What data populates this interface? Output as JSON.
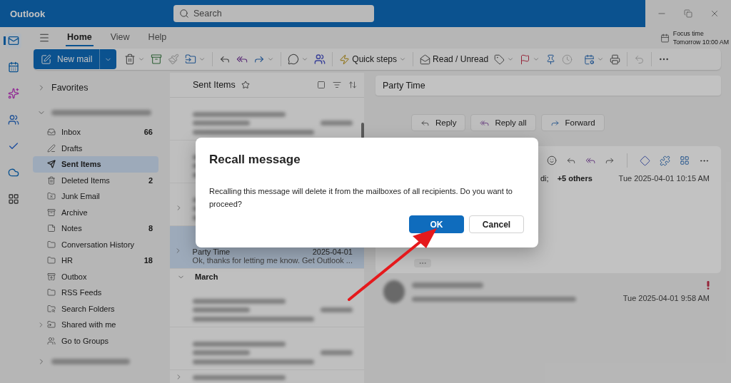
{
  "app": {
    "title": "Outlook"
  },
  "search": {
    "placeholder": "Search"
  },
  "rail": [
    {
      "kind": "mail",
      "selected": true
    },
    {
      "kind": "calendar",
      "selected": false
    },
    {
      "kind": "copilot",
      "selected": false
    },
    {
      "kind": "people",
      "selected": false
    },
    {
      "kind": "todo",
      "selected": false
    },
    {
      "kind": "onedrive",
      "selected": false
    },
    {
      "kind": "apps",
      "selected": false
    }
  ],
  "ribbon_tabs": [
    {
      "label": "Home",
      "selected": true
    },
    {
      "label": "View",
      "selected": false
    },
    {
      "label": "Help",
      "selected": false
    }
  ],
  "focus_time": {
    "title": "Focus time",
    "time": "Tomorrow 10:00 AM"
  },
  "toolbar": {
    "new_mail": "New mail",
    "quick_steps": "Quick steps",
    "read_unread": "Read / Unread"
  },
  "folders": {
    "favorites": "Favorites",
    "items": [
      {
        "kind": "inbox",
        "name": "Inbox",
        "count": "66",
        "selected": false,
        "has_children": false
      },
      {
        "kind": "drafts",
        "name": "Drafts",
        "selected": false,
        "has_children": false
      },
      {
        "kind": "sent",
        "name": "Sent Items",
        "selected": true,
        "has_children": false
      },
      {
        "kind": "deleted",
        "name": "Deleted Items",
        "count": "2",
        "selected": false,
        "has_children": false
      },
      {
        "kind": "junk",
        "name": "Junk Email",
        "selected": false,
        "has_children": false
      },
      {
        "kind": "archive",
        "name": "Archive",
        "selected": false,
        "has_children": false
      },
      {
        "kind": "notes",
        "name": "Notes",
        "count": "8",
        "selected": false,
        "has_children": false
      },
      {
        "kind": "folder",
        "name": "Conversation History",
        "selected": false,
        "has_children": false
      },
      {
        "kind": "folder",
        "name": "HR",
        "count": "18",
        "selected": false,
        "has_children": false
      },
      {
        "kind": "outbox",
        "name": "Outbox",
        "selected": false,
        "has_children": false
      },
      {
        "kind": "folder",
        "name": "RSS Feeds",
        "selected": false,
        "has_children": false
      },
      {
        "kind": "search",
        "name": "Search Folders",
        "selected": false,
        "has_children": false
      },
      {
        "kind": "shared",
        "name": "Shared with me",
        "selected": false,
        "has_children": true
      },
      {
        "kind": "groups",
        "name": "Go to Groups",
        "selected": false,
        "has_children": false
      }
    ]
  },
  "message_list": {
    "title": "Sent Items",
    "rows": [
      {
        "kind": "redacted",
        "selected": false,
        "thread": false
      },
      {
        "kind": "covered",
        "selected": false,
        "thread": false
      },
      {
        "kind": "covered",
        "selected": false,
        "thread": true
      },
      {
        "kind": "message",
        "selected": true,
        "thread": true,
        "subject": "Party Time",
        "date": "2025-04-01",
        "preview": "Ok, thanks for letting me know. Get Outlook ..."
      }
    ],
    "section": {
      "label": "March",
      "expanded": true,
      "rows": [
        {
          "kind": "redacted",
          "selected": false,
          "thread": false
        },
        {
          "kind": "redacted",
          "selected": false,
          "thread": false
        },
        {
          "kind": "cut",
          "selected": false,
          "thread": true
        }
      ]
    }
  },
  "reading_pane": {
    "subject": "Party Time",
    "actions": [
      "Reply",
      "Reply all",
      "Forward"
    ],
    "message": {
      "recipients_end": "di;",
      "others": "+5 others",
      "date": "Tue 2025-04-01 10:15 AM"
    },
    "earlier_message": {
      "important": true,
      "date": "Tue 2025-04-01 9:58 AM"
    }
  },
  "dialog": {
    "title": "Recall message",
    "text": "Recalling this message will delete it from the mailboxes of all recipients. Do you want to proceed?",
    "buttons": [
      {
        "label": "OK",
        "primary": true
      },
      {
        "label": "Cancel",
        "primary": false
      }
    ]
  }
}
